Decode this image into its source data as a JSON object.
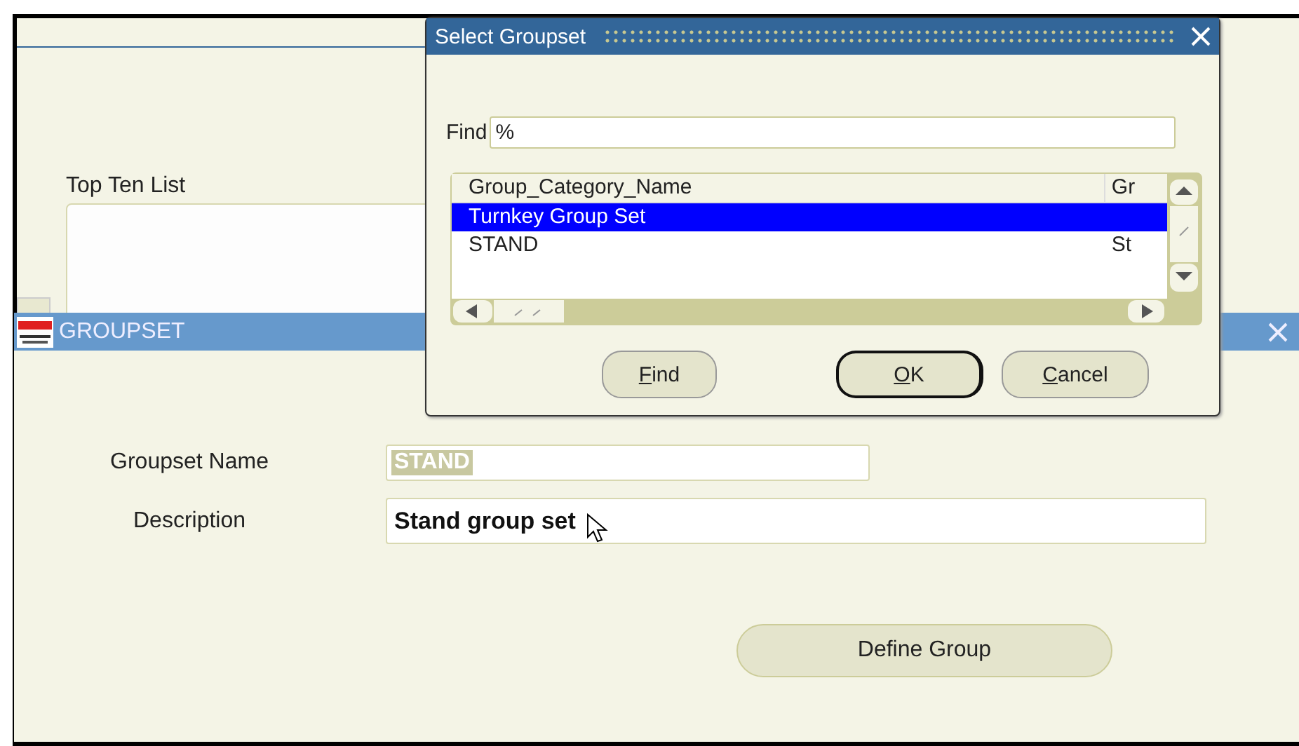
{
  "background_window": {
    "list_label": "Top Ten List"
  },
  "groupset_window": {
    "title": "GROUPSET",
    "fields": [
      {
        "label": "Groupset Name",
        "value": "STAND",
        "highlighted": true,
        "kind": "short"
      },
      {
        "label": "Description",
        "value": "Stand group set",
        "highlighted": false,
        "kind": "long"
      }
    ],
    "button": "Define Group"
  },
  "dialog": {
    "title": "Select Groupset",
    "find": {
      "label": "Find",
      "value": "%"
    },
    "list": {
      "columns": [
        "Group_Category_Name",
        "Gr"
      ],
      "rows": [
        {
          "column_1": "Turnkey Group Set",
          "selected": true
        },
        {
          "column_1": "STAND",
          "column_2": "St",
          "selected": false
        }
      ]
    },
    "buttons": [
      {
        "access_key": "F",
        "label_rest": "ind",
        "default": false
      },
      {
        "access_key": "O",
        "label_rest": "K",
        "default": true
      },
      {
        "access_key": "C",
        "label_rest": "ancel",
        "default": false
      }
    ]
  }
}
